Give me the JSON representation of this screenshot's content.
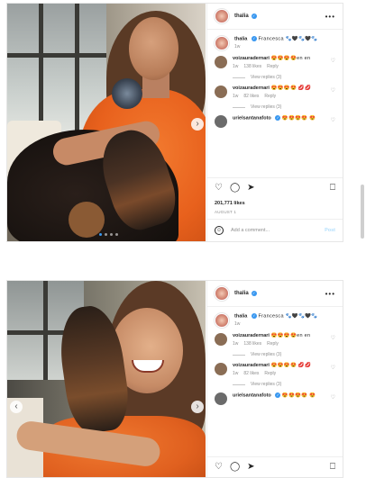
{
  "posts": [
    {
      "username": "thalia",
      "verified_mark": "✓",
      "more_label": "•••",
      "caption_user": "thalia",
      "caption_text": "Francesca 🐾🖤🐾🖤🐾",
      "caption_time": "1w",
      "comments": [
        {
          "user": "voizauradernari",
          "text": "😍😍😍😍en en",
          "time": "1w",
          "likes": "138 likes",
          "reply": "Reply",
          "view_replies": "View replies (3)",
          "avatar_color": "#8a6d55"
        },
        {
          "user": "voizauradernari",
          "text": "😍😍😍😍 💋💋",
          "time": "1w",
          "likes": "82 likes",
          "reply": "Reply",
          "view_replies": "View replies (3)",
          "avatar_color": "#8a6d55"
        },
        {
          "user": "urielsantanafoto",
          "text": "😍😍😍😍 😍",
          "time": "",
          "likes": "",
          "reply": "",
          "view_replies": "",
          "avatar_color": "#6b6b6b"
        }
      ],
      "likes": "201,771 likes",
      "date": "AUGUST 1",
      "add_comment_placeholder": "Add a comment...",
      "post_label": "Post",
      "icons": {
        "heart": "heart-icon",
        "comment": "comment-icon",
        "share": "share-icon",
        "save": "bookmark-icon",
        "smiley": "emoji-icon"
      }
    },
    {
      "username": "thalia",
      "verified_mark": "✓",
      "more_label": "•••",
      "caption_user": "thalia",
      "caption_text": "Francesca 🐾🖤🐾🖤🐾",
      "caption_time": "1w",
      "comments": [
        {
          "user": "voizauradernari",
          "text": "😍😍😍😍en en",
          "time": "1w",
          "likes": "138 likes",
          "reply": "Reply",
          "view_replies": "View replies (3)",
          "avatar_color": "#8a6d55"
        },
        {
          "user": "voizauradernari",
          "text": "😍😍😍😍 💋💋",
          "time": "1w",
          "likes": "82 likes",
          "reply": "Reply",
          "view_replies": "View replies (3)",
          "avatar_color": "#8a6d55"
        },
        {
          "user": "urielsantanafoto",
          "text": "😍😍😍😍 😍",
          "time": "",
          "likes": "",
          "reply": "",
          "view_replies": "",
          "avatar_color": "#6b6b6b"
        }
      ]
    }
  ],
  "colors": {
    "accent": "#3897f0",
    "dress": "#e8611d",
    "text": "#262626",
    "muted": "#8e8e8e"
  }
}
